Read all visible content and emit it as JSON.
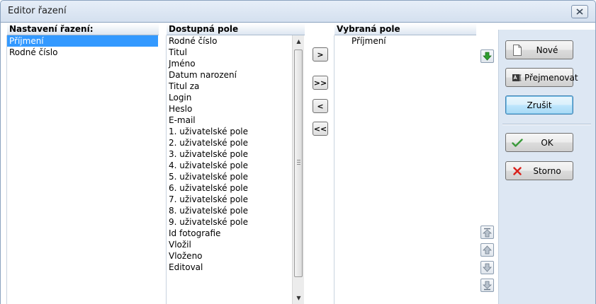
{
  "window": {
    "title": "Editor řazení"
  },
  "sort_settings": {
    "header": "Nastavení řazení:",
    "items": [
      "Příjmení",
      "Rodné číslo"
    ],
    "selected_index": 0
  },
  "available_fields": {
    "header": "Dostupná pole",
    "items": [
      "Rodné číslo",
      "Titul",
      "Jméno",
      "Datum narození",
      "Titul za",
      "Login",
      "Heslo",
      "E-mail",
      "1. uživatelské pole",
      "2. uživatelské pole",
      "3. uživatelské pole",
      "4. uživatelské pole",
      "5. uživatelské pole",
      "6. uživatelské pole",
      "7. uživatelské pole",
      "8. uživatelské pole",
      "9. uživatelské pole",
      "Id fotografie",
      "Vložil",
      "Vloženo",
      "Editoval"
    ]
  },
  "selected_fields": {
    "header": "Vybraná pole",
    "items": [
      "Příjmení"
    ]
  },
  "movers": {
    "add": ">",
    "add_all": ">>",
    "remove": "<",
    "remove_all": "<<"
  },
  "actions": {
    "new_label": "Nové",
    "rename_label": "Přejmenovat",
    "cancel_label": "Zrušit",
    "ok_label": "OK",
    "storno_label": "Storno"
  },
  "colors": {
    "selection": "#3399ff",
    "side_panel": "#dde7f3",
    "ok_check": "#3a9a3a",
    "storno_x": "#d9201a",
    "green_arrow": "#2f9e2f"
  },
  "icons": [
    "close-icon",
    "down-green-arrow-icon",
    "new-document-icon",
    "rename-icon",
    "check-icon",
    "x-icon",
    "move-top-icon",
    "move-up-icon",
    "move-down-icon",
    "move-bottom-icon"
  ]
}
